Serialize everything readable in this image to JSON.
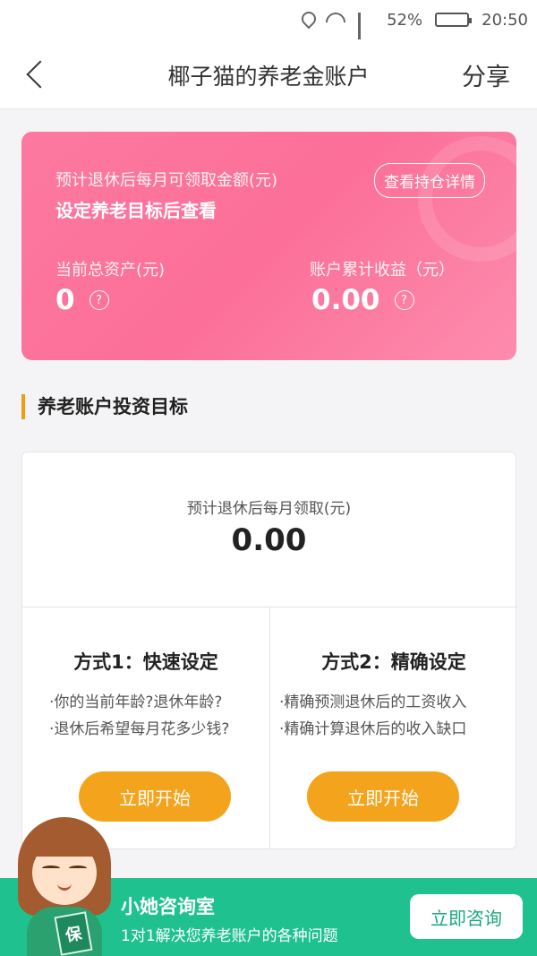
{
  "status_bar": {
    "battery": "52%",
    "battery_level": 0.52,
    "time": "20:50",
    "icons": [
      "location-icon",
      "wifi-icon",
      "signal-icon",
      "battery-icon"
    ]
  },
  "nav": {
    "title": "椰子猫的养老金账户",
    "share": "分享"
  },
  "summary_card": {
    "label": "预计退休后每月可领取金额(元)",
    "sub": "设定养老目标后查看",
    "holdings_button": "查看持仓详情",
    "total_assets_label": "当前总资产(元)",
    "total_assets_value": "0",
    "earnings_label": "账户累计收益（元）",
    "earnings_value": "0.00",
    "help_glyph": "?",
    "gradient": [
      "#fd79a0",
      "#fd8cae"
    ]
  },
  "section": {
    "title": "养老账户投资目标",
    "accent_color": "#f39c12"
  },
  "target": {
    "label": "预计退休后每月领取(元)",
    "value": "0.00",
    "methods": [
      {
        "title": "方式1：快速设定",
        "lines": [
          "·你的当前年龄?退休年龄?",
          "·退休后希望每月花多少钱?"
        ],
        "button": "立即开始"
      },
      {
        "title": "方式2：精确设定",
        "lines": [
          "·精确预测退休后的工资收入",
          "·精确计算退休后的收入缺口"
        ],
        "button": "立即开始"
      }
    ],
    "button_color": "#f4a41c"
  },
  "consult_bar": {
    "title": "小她咨询室",
    "subtitle": "1对1解决您养老账户的各种问题",
    "button": "立即咨询",
    "mascot_book_text": "保",
    "color": "#1fc18f"
  }
}
